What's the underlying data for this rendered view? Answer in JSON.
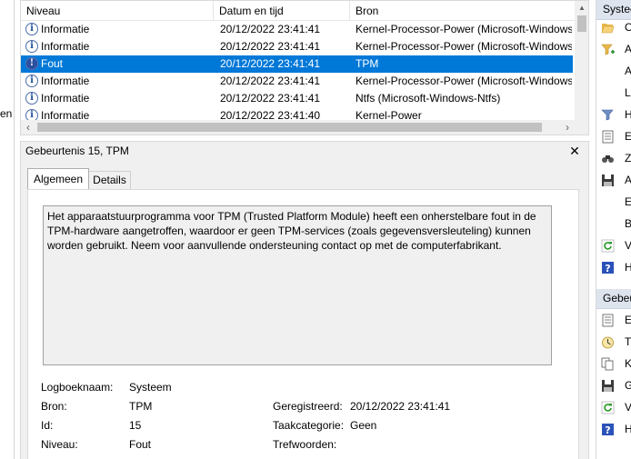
{
  "left_pane": {
    "fragment": "en"
  },
  "event_list": {
    "columns": [
      "Niveau",
      "Datum en tijd",
      "Bron"
    ],
    "rows": [
      {
        "level": "Informatie",
        "datetime": "20/12/2022 23:41:41",
        "source": "Kernel-Processor-Power (Microsoft-Windows",
        "icon": "info-icon",
        "selected": false
      },
      {
        "level": "Informatie",
        "datetime": "20/12/2022 23:41:41",
        "source": "Kernel-Processor-Power (Microsoft-Windows",
        "icon": "info-icon",
        "selected": false
      },
      {
        "level": "Fout",
        "datetime": "20/12/2022 23:41:41",
        "source": "TPM",
        "icon": "error-icon",
        "selected": true
      },
      {
        "level": "Informatie",
        "datetime": "20/12/2022 23:41:41",
        "source": "Kernel-Processor-Power (Microsoft-Windows",
        "icon": "info-icon",
        "selected": false
      },
      {
        "level": "Informatie",
        "datetime": "20/12/2022 23:41:41",
        "source": "Ntfs (Microsoft-Windows-Ntfs)",
        "icon": "info-icon",
        "selected": false
      },
      {
        "level": "Informatie",
        "datetime": "20/12/2022 23:41:40",
        "source": "Kernel-Power",
        "icon": "info-icon",
        "selected": false
      }
    ]
  },
  "detail": {
    "title": "Gebeurtenis 15, TPM",
    "tabs": {
      "general": "Algemeen",
      "details": "Details"
    },
    "message": "Het apparaatstuurprogramma voor TPM (Trusted Platform Module) heeft een onherstelbare fout in de TPM-hardware aangetroffen, waardoor er geen TPM-services (zoals gegevensversleuteling) kunnen worden gebruikt. Neem voor aanvullende ondersteuning contact op met de computerfabrikant.",
    "fields": {
      "log_name_label": "Logboeknaam:",
      "log_name": "Systeem",
      "source_label": "Bron:",
      "source": "TPM",
      "logged_label": "Geregistreerd:",
      "logged": "20/12/2022 23:41:41",
      "id_label": "Id:",
      "id": "15",
      "task_label": "Taakcategorie:",
      "task": "Geen",
      "level_label": "Niveau:",
      "level": "Fout",
      "keywords_label": "Trefwoorden:",
      "keywords": ""
    }
  },
  "actions": {
    "section1_header": "Systee",
    "section1_items": [
      {
        "label": "O",
        "icon": "folder-open-icon"
      },
      {
        "label": "A",
        "icon": "filter-add-icon"
      },
      {
        "label": "A",
        "icon": "blank"
      },
      {
        "label": "L",
        "icon": "blank"
      },
      {
        "label": "H",
        "icon": "filter-icon"
      },
      {
        "label": "E",
        "icon": "properties-icon"
      },
      {
        "label": "Z",
        "icon": "find-icon"
      },
      {
        "label": "A",
        "icon": "save-icon"
      },
      {
        "label": "E",
        "icon": "blank"
      },
      {
        "label": "B",
        "icon": "blank"
      },
      {
        "label": "V",
        "icon": "refresh-icon"
      },
      {
        "label": "H",
        "icon": "help-icon"
      }
    ],
    "section2_header": "Gebeu",
    "section2_items": [
      {
        "label": "E",
        "icon": "event-properties-icon"
      },
      {
        "label": "T",
        "icon": "attach-task-icon"
      },
      {
        "label": "K",
        "icon": "copy-icon"
      },
      {
        "label": "G",
        "icon": "save-icon"
      },
      {
        "label": "V",
        "icon": "refresh-icon"
      },
      {
        "label": "H",
        "icon": "help-icon"
      }
    ]
  }
}
